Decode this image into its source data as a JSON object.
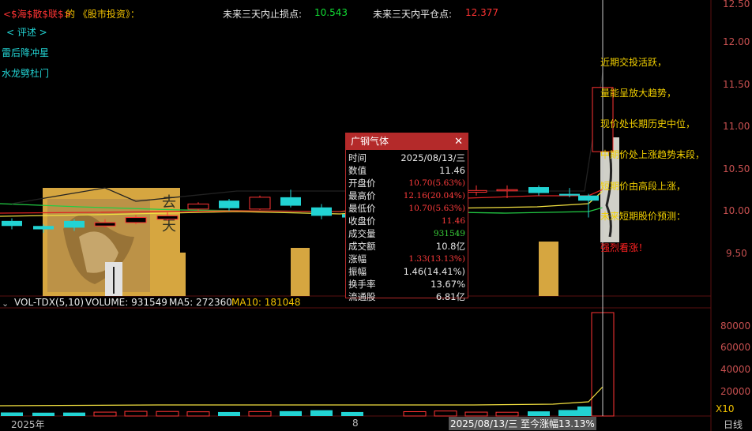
{
  "header": {
    "title_left": "<$海$散$联$>",
    "title_mid": "的 《股市投资》：",
    "stop_loss_label": "未来三天内止损点:",
    "stop_loss_value": "10.543",
    "flat_label": "未来三天内平仓点:",
    "flat_value": "12.377"
  },
  "sidebar": {
    "review": "< 评述 >",
    "signal1": "雷后降冲星",
    "signal2": "水龙劈杜门"
  },
  "price_axis": [
    "12.50",
    "12.00",
    "11.50",
    "11.00",
    "10.50",
    "10.00",
    "9.50"
  ],
  "comments": [
    "近期交投活跃，",
    "量能呈放大趋势，",
    "现价处长期历史中位，",
    "中期价处上涨趋势末段，",
    "短期价由高段上涨，",
    "未来短期股价预测：",
    "强烈看涨！"
  ],
  "popup": {
    "title": "广钢气体",
    "rows": [
      {
        "k": "时间",
        "v": "2025/08/13/三",
        "cls": ""
      },
      {
        "k": "数值",
        "v": "11.46",
        "cls": ""
      },
      {
        "k": "开盘价",
        "v": "10.70(5.63%)",
        "cls": "red"
      },
      {
        "k": "最高价",
        "v": "12.16(20.04%)",
        "cls": "red"
      },
      {
        "k": "最低价",
        "v": "10.70(5.63%)",
        "cls": "red"
      },
      {
        "k": "收盘价",
        "v": "11.46",
        "cls": "red"
      },
      {
        "k": "成交量",
        "v": "931549",
        "cls": "grn"
      },
      {
        "k": "成交额",
        "v": "10.8亿",
        "cls": ""
      },
      {
        "k": "涨幅",
        "v": "1.33(13.13%)",
        "cls": "red"
      },
      {
        "k": "振幅",
        "v": "1.46(14.41%)",
        "cls": ""
      },
      {
        "k": "换手率",
        "v": "13.67%",
        "cls": ""
      },
      {
        "k": "流通股",
        "v": "6.81亿",
        "cls": ""
      }
    ]
  },
  "volume": {
    "indicator": "VOL-TDX(5,10)",
    "volume_label": "VOLUME: 931549",
    "ma5_label": "MA5: 272360",
    "ma10_label": "MA10: 181048",
    "axis": [
      "80000",
      "60000",
      "40000",
      "20000"
    ],
    "unit": "X10"
  },
  "footer": {
    "year": "2025年",
    "month": "8",
    "cursor_date": "2025/08/13/三  至今涨幅13.13%",
    "period": "日线"
  },
  "colors": {
    "up": "#ff3333",
    "down": "#22d3d3",
    "ma_yellow": "#f2e040",
    "ma_green": "#22cc44",
    "ma_red": "#dd2222"
  },
  "candles": [
    {
      "o": 9.88,
      "c": 9.82,
      "h": 9.91,
      "l": 9.78
    },
    {
      "o": 9.82,
      "c": 9.78,
      "h": 9.84,
      "l": 9.74
    },
    {
      "o": 9.88,
      "c": 9.8,
      "h": 9.9,
      "l": 9.76
    },
    {
      "o": 9.82,
      "c": 9.86,
      "h": 9.9,
      "l": 9.8
    },
    {
      "o": 9.86,
      "c": 9.92,
      "h": 9.95,
      "l": 9.84
    },
    {
      "o": 9.9,
      "c": 9.94,
      "h": 9.98,
      "l": 9.88
    },
    {
      "o": 10.02,
      "c": 10.08,
      "h": 10.1,
      "l": 10.0
    },
    {
      "o": 10.12,
      "c": 10.03,
      "h": 10.14,
      "l": 10.0
    },
    {
      "o": 10.02,
      "c": 10.16,
      "h": 10.18,
      "l": 10.01
    },
    {
      "o": 10.16,
      "c": 10.06,
      "h": 10.25,
      "l": 10.04
    },
    {
      "o": 10.04,
      "c": 9.94,
      "h": 10.08,
      "l": 9.9
    },
    {
      "o": 9.96,
      "c": 9.92,
      "h": 10.0,
      "l": 9.89
    },
    {
      "o": 9.97,
      "c": 10.03,
      "h": 10.06,
      "l": 9.95
    },
    {
      "o": 10.05,
      "c": 10.05,
      "h": 10.07,
      "l": 10.03
    },
    {
      "o": 10.22,
      "c": 10.24,
      "h": 10.3,
      "l": 10.18
    },
    {
      "o": 10.25,
      "c": 10.25,
      "h": 10.3,
      "l": 10.15
    },
    {
      "o": 10.28,
      "c": 10.21,
      "h": 10.3,
      "l": 10.18
    },
    {
      "o": 10.2,
      "c": 10.18,
      "h": 10.27,
      "l": 10.16
    },
    {
      "o": 10.18,
      "c": 10.12,
      "h": 10.2,
      "l": 9.92
    },
    {
      "o": 10.7,
      "c": 11.46,
      "h": 12.16,
      "l": 10.7
    }
  ],
  "volumes": [
    3200,
    3000,
    3100,
    3500,
    4200,
    4100,
    3800,
    3600,
    4000,
    4400,
    5200,
    3600,
    3900,
    4500,
    3500,
    3400,
    4200,
    5400,
    8600,
    93155
  ]
}
